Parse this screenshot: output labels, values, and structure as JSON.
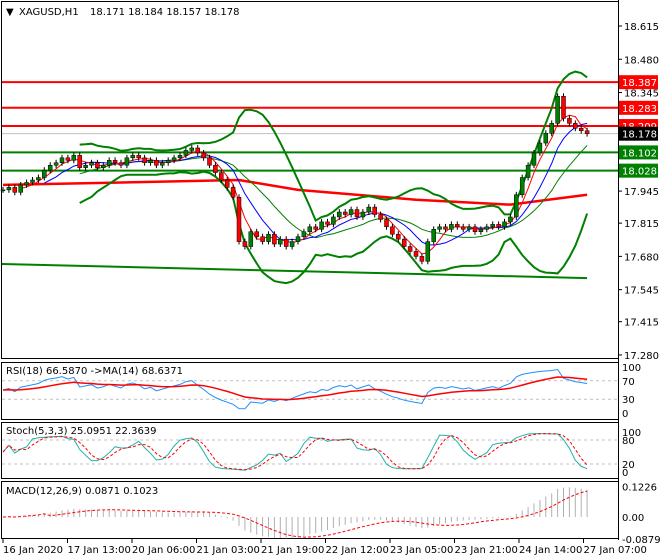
{
  "header": {
    "symbol": "XAGUSD,H1",
    "ohlc": "18.171 18.184 18.157 18.178"
  },
  "chart_data": {
    "type": "line",
    "title": "XAGUSD,H1",
    "ylim": [
      17.28,
      18.68
    ],
    "y_ticks": [
      "18.615",
      "18.480",
      "18.345",
      "17.945",
      "17.815",
      "17.680",
      "17.545",
      "17.415",
      "17.280"
    ],
    "x_ticks": [
      "16 Jan 2020",
      "17 Jan 13:00",
      "20 Jan 06:00",
      "21 Jan 03:00",
      "21 Jan 19:00",
      "22 Jan 12:00",
      "23 Jan 05:00",
      "23 Jan 21:00",
      "24 Jan 14:00",
      "27 Jan 07:00"
    ],
    "close": [
      17.95,
      17.96,
      17.94,
      17.97,
      17.98,
      17.99,
      18.0,
      18.03,
      18.05,
      18.06,
      18.08,
      18.07,
      18.09,
      18.04,
      18.05,
      18.06,
      18.04,
      18.05,
      18.07,
      18.06,
      18.05,
      18.08,
      18.09,
      18.08,
      18.06,
      18.07,
      18.05,
      18.06,
      18.07,
      18.08,
      18.09,
      18.11,
      18.12,
      18.1,
      18.08,
      18.05,
      18.02,
      17.99,
      17.96,
      17.92,
      17.74,
      17.72,
      17.78,
      17.76,
      17.74,
      17.77,
      17.73,
      17.75,
      17.72,
      17.74,
      17.76,
      17.78,
      17.8,
      17.79,
      17.82,
      17.81,
      17.84,
      17.86,
      17.85,
      17.87,
      17.84,
      17.86,
      17.88,
      17.85,
      17.83,
      17.8,
      17.77,
      17.75,
      17.72,
      17.7,
      17.68,
      17.66,
      17.74,
      17.79,
      17.8,
      17.79,
      17.81,
      17.8,
      17.79,
      17.8,
      17.78,
      17.79,
      17.8,
      17.81,
      17.8,
      17.82,
      17.84,
      17.93,
      18.0,
      18.05,
      18.1,
      18.14,
      18.18,
      18.22,
      18.33,
      18.24,
      18.22,
      18.2,
      18.19,
      18.178
    ],
    "long_ma": [
      [
        0,
        17.97
      ],
      [
        40,
        17.99
      ],
      [
        50,
        17.95
      ],
      [
        70,
        17.91
      ],
      [
        86,
        17.89
      ],
      [
        99,
        17.93
      ]
    ],
    "trendline": [
      [
        0,
        17.649
      ],
      [
        99,
        17.592
      ]
    ],
    "levels": [
      {
        "value": "18.387",
        "color": "#ff0000"
      },
      {
        "value": "18.283",
        "color": "#ff0000"
      },
      {
        "value": "18.209",
        "color": "#ff0000"
      },
      {
        "value": "18.102",
        "color": "#008000"
      },
      {
        "value": "18.028",
        "color": "#008000"
      }
    ],
    "current_price": "18.178",
    "rsi": {
      "label": "RSI(18) 66.5870  ->MA(14) 68.6371",
      "ticks": [
        "100",
        "70",
        "30",
        "0"
      ]
    },
    "stoch": {
      "label": "Stoch(5,3,3) 25.0951 22.3639",
      "ticks": [
        "100",
        "80",
        "20",
        "0"
      ]
    },
    "macd": {
      "label": "MACD(12,26,9) 0.0871 0.1023",
      "ticks": [
        "0.1226",
        "0.00",
        "-0.0879"
      ]
    }
  }
}
